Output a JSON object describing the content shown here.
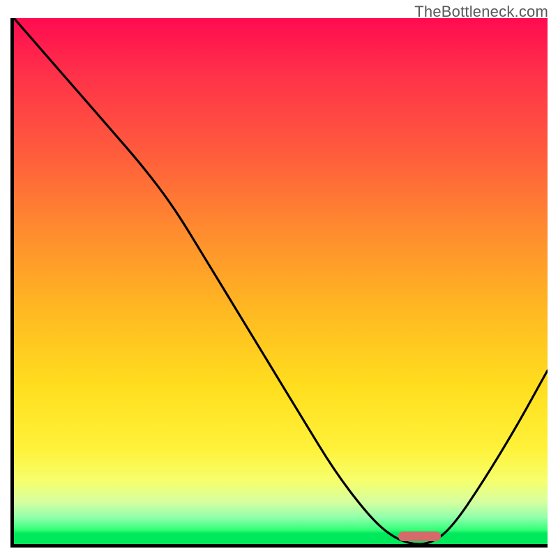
{
  "watermark": "TheBottleneck.com",
  "colors": {
    "axis": "#000000",
    "curve": "#000000",
    "marker": "#d66a6a",
    "gradient_top": "#ff0b50",
    "gradient_bottom": "#00e85b"
  },
  "chart_data": {
    "type": "line",
    "title": "",
    "xlabel": "",
    "ylabel": "",
    "xlim": [
      0,
      100
    ],
    "ylim": [
      0,
      100
    ],
    "grid": false,
    "legend": false,
    "series": [
      {
        "name": "bottleneck-curve",
        "x": [
          0,
          6,
          12,
          18,
          24,
          30,
          36,
          42,
          48,
          54,
          60,
          66,
          70,
          74,
          78,
          82,
          88,
          94,
          100
        ],
        "y": [
          100,
          93,
          86,
          79,
          72,
          64,
          54,
          44,
          34,
          24,
          14,
          6,
          2,
          0,
          0,
          3,
          12,
          22,
          33
        ]
      }
    ],
    "optimum_range_x": [
      72,
      80
    ],
    "annotations": []
  }
}
